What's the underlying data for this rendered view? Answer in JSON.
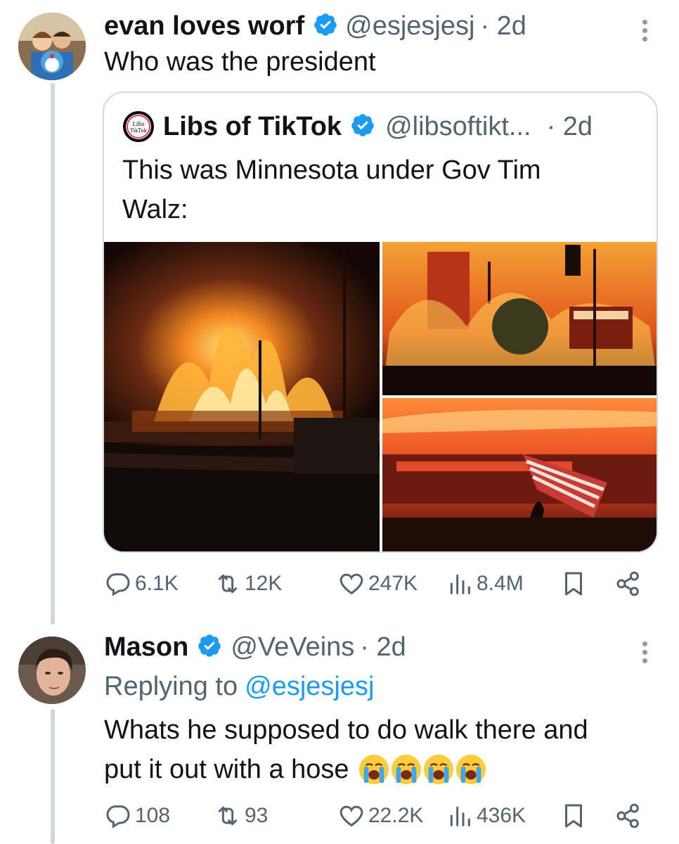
{
  "tweet1": {
    "display_name": "evan loves worf",
    "handle": "@esjesjesj",
    "time": "· 2d",
    "text": "Who was the president"
  },
  "quote": {
    "display_name": "Libs of TikTok",
    "handle": "@libsoftikt...",
    "time": "· 2d",
    "text_line1": "This was Minnesota under Gov Tim",
    "text_line2": "Walz:",
    "logo_text": "Libs of TikTok"
  },
  "tweet1_stats": {
    "replies": "6.1K",
    "retweets": "12K",
    "likes": "247K",
    "views": "8.4M"
  },
  "tweet2": {
    "display_name": "Mason",
    "handle": "@VeVeins",
    "time": "· 2d",
    "replying_prefix": "Replying to",
    "replying_to": "@esjesjesj",
    "text_line1": "Whats he supposed to do walk there and",
    "text_line2": "put it out with a hose"
  },
  "tweet2_stats": {
    "replies": "108",
    "retweets": "93",
    "likes": "22.2K",
    "views": "436K"
  },
  "colors": {
    "verified": "#1d9bf0",
    "link": "#1d9bf0",
    "secondary_text": "#536471",
    "border": "#cfd9de"
  },
  "icons": [
    "verified-badge-icon",
    "more-icon",
    "reply-icon",
    "retweet-icon",
    "like-icon",
    "views-icon",
    "bookmark-icon",
    "share-icon",
    "loudly-crying-face-emoji"
  ]
}
